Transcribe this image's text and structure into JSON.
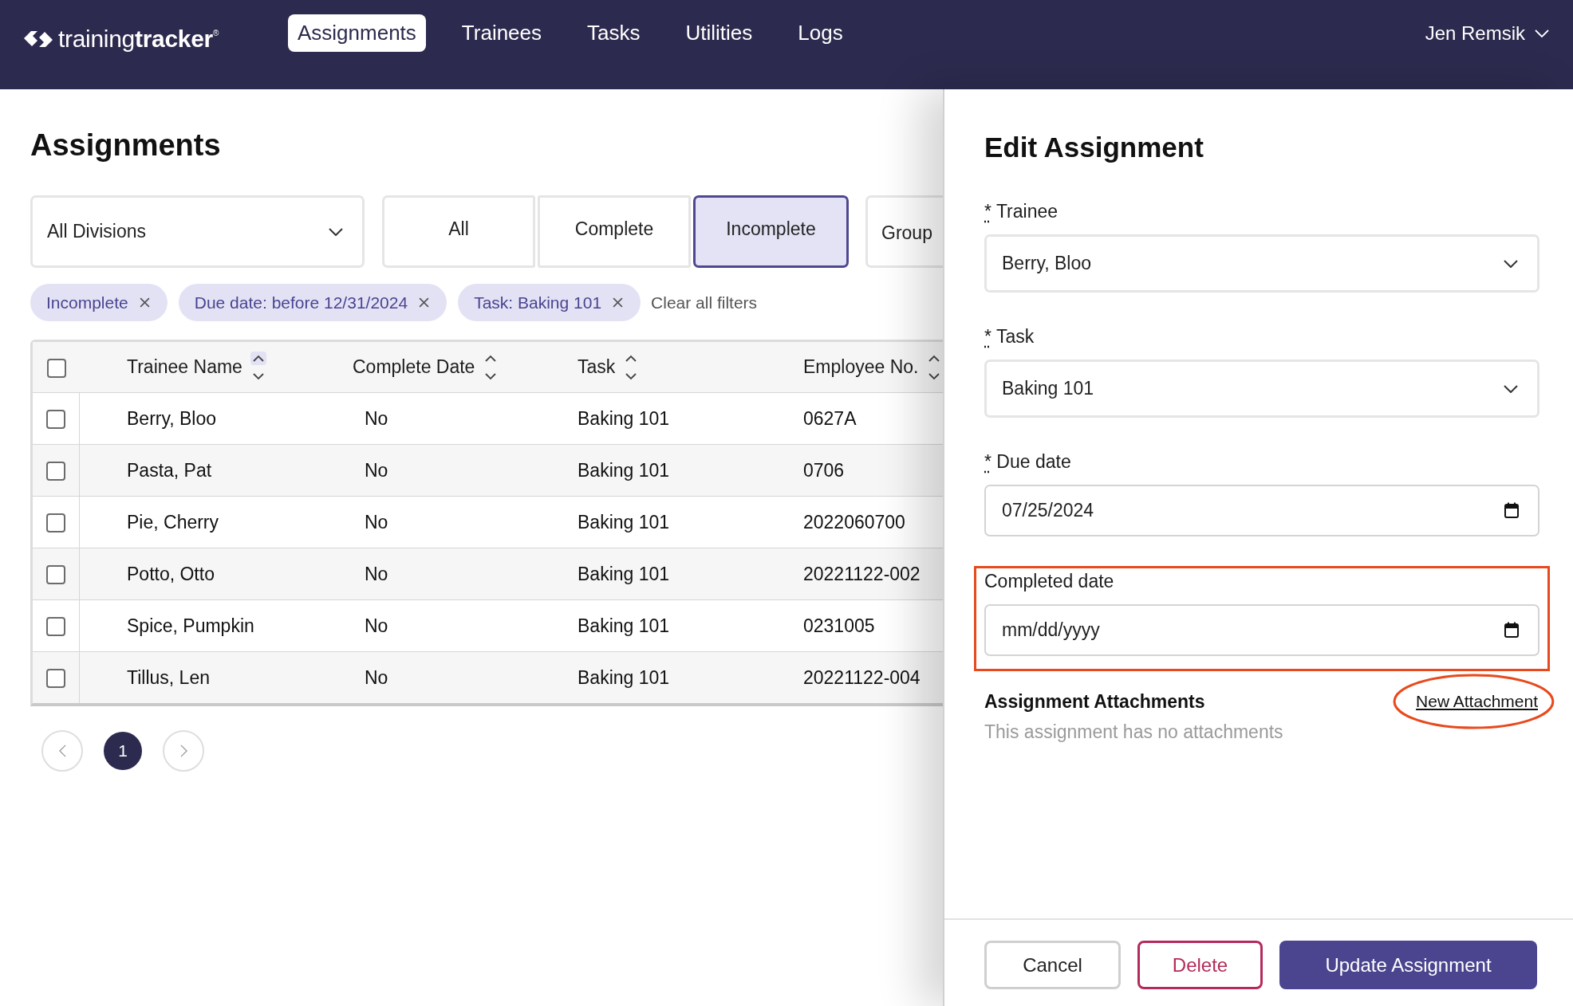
{
  "top_bar": {
    "logo": "training**tracker**$^{®}$",
    "nav": [
      {
        "label": "Assignments",
        "selected": true
      },
      {
        "label": "Trainees",
        "selected": false
      },
      {
        "label": "Tasks",
        "selected": false
      },
      {
        "label": "Utilities",
        "selected": false
      },
      {
        "label": "Logs",
        "selected": false
      }
    ],
    "user": {
      "name": "Jen Remsik"
    }
  },
  "assignments": {
    "title": "Assignments",
    "division_select": {
      "value": "All Divisions"
    },
    "status_filters": [
      {
        "label": "All",
        "selected": false
      },
      {
        "label": "Complete",
        "selected": false
      },
      {
        "label": "Incomplete",
        "selected": true
      }
    ],
    "group_button": {
      "label": "Group"
    },
    "active_filters": [
      {
        "label": "Incomplete"
      },
      {
        "label": "Due date: before 12/31/2024"
      },
      {
        "label": "Task: Baking 101"
      }
    ],
    "clear_filters": "Clear all filters",
    "table": {
      "select_all": {
        "checked": false
      },
      "columns": [
        {
          "label": "Trainee Name",
          "sorted": true
        },
        {
          "label": "Complete Date",
          "sorted": false
        },
        {
          "label": "Task",
          "sorted": false
        },
        {
          "label": "Employee No.",
          "sorted": false
        }
      ],
      "rows": [
        {
          "checked": false,
          "cells": [
            "Berry, Bloo",
            "No",
            "Baking 101",
            "0627A"
          ]
        },
        {
          "checked": false,
          "cells": [
            "Pasta, Pat",
            "No",
            "Baking 101",
            "0706"
          ]
        },
        {
          "checked": false,
          "cells": [
            "Pie, Cherry",
            "No",
            "Baking 101",
            "2022060700"
          ]
        },
        {
          "checked": false,
          "cells": [
            "Potto, Otto",
            "No",
            "Baking 101",
            "20221122-002"
          ]
        },
        {
          "checked": false,
          "cells": [
            "Spice, Pumpkin",
            "No",
            "Baking 101",
            "0231005"
          ]
        },
        {
          "checked": false,
          "cells": [
            "Tillus, Len",
            "No",
            "Baking 101",
            "20221122-004"
          ]
        }
      ]
    },
    "pagination": {
      "pages": [
        {
          "label": "1",
          "selected": true
        }
      ]
    }
  },
  "edit_panel": {
    "title": "Edit Assignment",
    "fields": [
      {
        "kind": "select",
        "required_mark": "*",
        "label": "Trainee",
        "value": "Berry, Bloo",
        "annotated": false
      },
      {
        "kind": "select",
        "required_mark": "*",
        "label": "Task",
        "value": "Baking 101",
        "annotated": false
      },
      {
        "kind": "date",
        "required_mark": "*",
        "label": "Due date",
        "value": "07/25/2024",
        "annotated": false
      },
      {
        "kind": "date",
        "label": "Completed date",
        "placeholder": "mm/dd/yyyy",
        "annotated": true
      }
    ],
    "attachments": {
      "title": "Assignment Attachments",
      "link": {
        "label": "New Attachment",
        "annotated": true
      },
      "empty_text": "This assignment has no attachments"
    },
    "buttons": [
      {
        "kind": "secondary",
        "label": "Cancel"
      },
      {
        "kind": "danger",
        "label": "Delete"
      },
      {
        "kind": "primary",
        "label": "Update Assignment"
      }
    ]
  }
}
